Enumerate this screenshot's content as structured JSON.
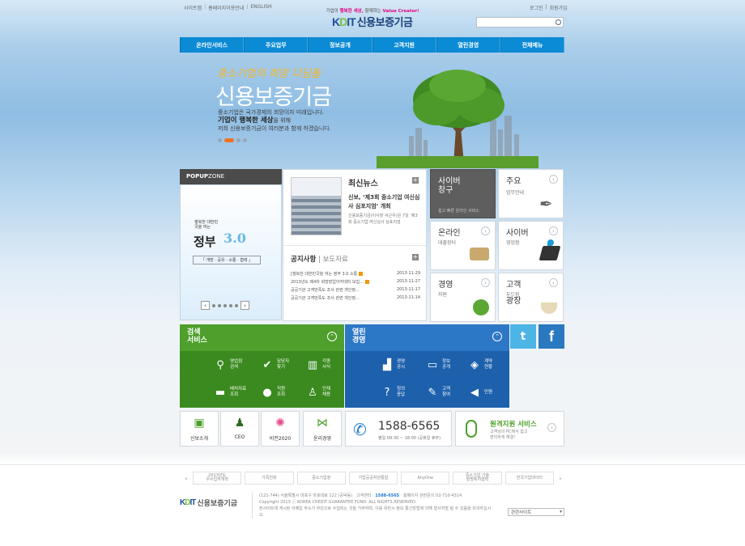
{
  "header": {
    "util_links": [
      "사이트맵",
      "홈페이지이용안내",
      "ENGLISH"
    ],
    "user_links": [
      "로그인",
      "회원가입"
    ],
    "tagline_pre": "기업이",
    "tagline_mid": "행복한 세상,",
    "tagline_post": "함께하는",
    "tagline_end": "Value Creator!",
    "logo_mark_a": "K",
    "logo_mark_b": "D",
    "logo_mark_c": "IT",
    "logo_name": "신용보증기금",
    "search_placeholder": ""
  },
  "gnb": [
    "온라인서비스",
    "주요업무",
    "정보공개",
    "고객지원",
    "열린경영",
    "전체메뉴"
  ],
  "hero": {
    "slogan": "중소기업의 희망 디딤돌",
    "title": "신용보증기금",
    "line1": "중소기업은 국가경제의 희망이자 미래입니다.",
    "line2": "기업이 행복한 세상",
    "line2b": "을 위해",
    "line3": "저희 신용보증기금이 여러분과 함께 하겠습니다.",
    "slide_count": 4,
    "active_slide": 1
  },
  "popup": {
    "header_bold": "POPUP",
    "header_rest": "ZONE",
    "kicker": "행복한 대한민국을 여는",
    "title_a": "정부",
    "title_b": "3.0",
    "tags": "「 개방 · 공유 · 소통 · 협력 」",
    "prev": "‹",
    "next": "›",
    "dot_count": 5
  },
  "news": {
    "heading": "최신뉴스",
    "plus": "+",
    "title": "신보, ‘제3회 중소기업 여신심사 심포지엄’ 개최",
    "desc": "신용보증기금(이사장 서근우)은 7일 ‘제3회 중소기업 여신심사 심포지엄",
    "notice_heading": "공지사항",
    "notice_sep": " | ",
    "notice_tab2": "보도자료",
    "notices": [
      {
        "title": "[행복한 대한민국을 여는 정부 3.0 소통",
        "new": true,
        "date": "2013-11-29"
      },
      {
        "title": "2013년도 제4차 희망장업아카데미 모집...",
        "new": true,
        "date": "2013-11-27"
      },
      {
        "title": "공공기관 고객만족도 조사 관련 개인정...",
        "new": false,
        "date": "2013-11-17"
      },
      {
        "title": "공공기관 고객만족도 조사 관련 개인정...",
        "new": false,
        "date": "2013-11-14"
      }
    ]
  },
  "tiles": {
    "cyber": {
      "title": "사이버\n창구",
      "sub": "쉽고 빠른 온라인 서비스"
    },
    "main": {
      "title": "주요",
      "sub": "업무안내",
      "arrow": "›"
    },
    "online": {
      "title": "온라인",
      "sub": "대출장터",
      "arrow": "›"
    },
    "cyberbiz": {
      "title": "사이버",
      "sub": "영업점",
      "arrow": "›"
    },
    "mgmt": {
      "title": "경영",
      "sub": "지원",
      "arrow": "›"
    },
    "plaza": {
      "title": "고객",
      "sub": "두드림",
      "sub2": "광장",
      "arrow": "›"
    }
  },
  "search_service": {
    "title": "검색\n서비스",
    "toggle": "⌃",
    "items": [
      {
        "label": "영업점\n검색",
        "icon": "search-person-icon",
        "glyph": "⚲"
      },
      {
        "label": "담당자\n찾기",
        "icon": "check-shield-icon",
        "glyph": "✔"
      },
      {
        "label": "각종\n서식",
        "icon": "books-icon",
        "glyph": "▥"
      },
      {
        "label": "배치자료\n조회",
        "icon": "briefcase-icon",
        "glyph": "▬"
      },
      {
        "label": "직원\n조회",
        "icon": "staff-icon",
        "glyph": "●"
      },
      {
        "label": "인재\n채용",
        "icon": "recruit-icon",
        "glyph": "♙"
      }
    ]
  },
  "open_mgmt": {
    "title": "열린\n경영",
    "toggle": "⌃",
    "items": [
      {
        "label": "경영\n공시",
        "icon": "bar-chart-icon",
        "glyph": "▟"
      },
      {
        "label": "정보\n공개",
        "icon": "monitor-icon",
        "glyph": "▭"
      },
      {
        "label": "계약\n현황",
        "icon": "document-icon",
        "glyph": "◈"
      },
      {
        "label": "칭의\n응답",
        "icon": "qa-icon",
        "glyph": "?"
      },
      {
        "label": "고객\n참여",
        "icon": "participate-icon",
        "glyph": "✎"
      },
      {
        "label": "민원",
        "icon": "megaphone-icon",
        "glyph": "◀"
      }
    ]
  },
  "social": {
    "twitter": "t",
    "facebook": "f"
  },
  "quick": [
    {
      "label": "신보소개",
      "icon": "doc-badge-icon",
      "glyph": "▣"
    },
    {
      "label": "CEO",
      "icon": "person-icon",
      "glyph": "♟"
    },
    {
      "label": "비전2020",
      "icon": "vision-icon",
      "glyph": "✺"
    },
    {
      "label": "윤리경영",
      "icon": "share-icon",
      "glyph": "⋈"
    }
  ],
  "call": {
    "number": "1588-6565",
    "hours": "평일 09:30 ~ 18:00 (공휴일 휴무)",
    "icon_glyph": "✆"
  },
  "remote": {
    "title": "원격지원 서비스",
    "desc": "고객님의 PC에서 쉽고\n편리하게 해결!",
    "arrow": "›"
  },
  "footer": {
    "banners": [
      "2013년도\n우수업무개혁",
      "가족친화",
      "중소기업청",
      "기업공공자원통합",
      "AnyOne",
      "중소기업 기술\n발명특허협력",
      "한국기업데이터"
    ],
    "prev": "‹",
    "next": "›",
    "logo_name": "신용보증기금",
    "address": "(121-744) 서울특별시 마포구 마포대로 122 (공덕동)",
    "center_label": "고객센터 :",
    "center_number": "1588-6565",
    "hotline": "홈페이지 관련문의 02-710-4314",
    "copyright": "Copyright 2013 ⓒ KOREA CREDIT GUARANTEE FUND. ALL RIGHTS RESERVED.",
    "notice": "본사이트에 게시된 이메일 주소가 무단으로 수집되는 것을 거부하며, 이를 위반시 정보 통신망법에 의해 형사처벌 될 수 있음을 유의하십시오.",
    "related_sites": "관련사이트",
    "related_arrow": "▾"
  },
  "colors": {
    "brand_blue": "#0c8bd5",
    "green": "#4e9f2c",
    "blue": "#2d77c7",
    "twitter": "#4cb5e6",
    "facebook": "#2a78c0"
  }
}
